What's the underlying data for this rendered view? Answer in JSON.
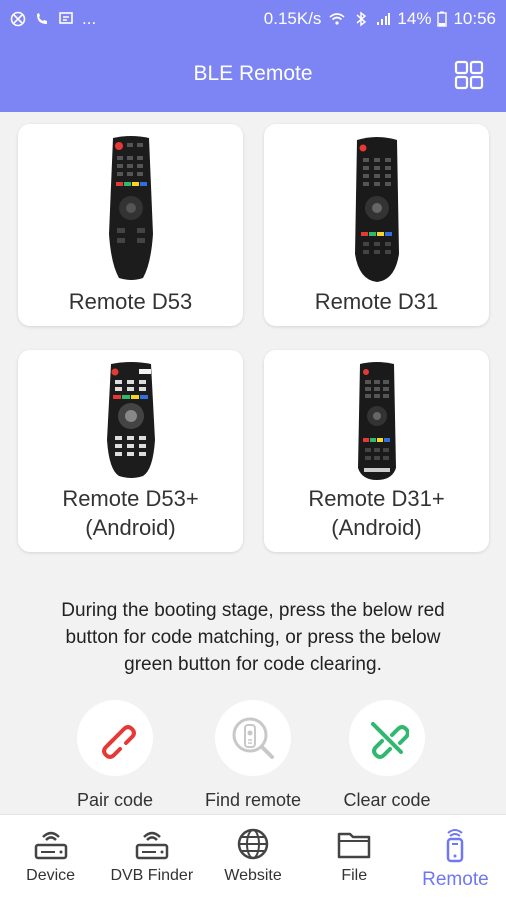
{
  "status_bar": {
    "dots": "...",
    "speed": "0.15K/s",
    "battery": "14%",
    "time": "10:56"
  },
  "app_bar": {
    "title": "BLE Remote",
    "grid_icon": "grid-icon"
  },
  "remotes": [
    {
      "label": "Remote D53"
    },
    {
      "label": "Remote D31"
    },
    {
      "label_line1": "Remote D53+",
      "label_line2": "(Android)"
    },
    {
      "label_line1": "Remote D31+",
      "label_line2": "(Android)"
    }
  ],
  "instructions": {
    "line1": "During the booting stage, press the below red",
    "line2": "button for code matching, or press the below",
    "line3": "green button for code clearing."
  },
  "actions": [
    {
      "label": "Pair code",
      "icon": "link-icon",
      "color": "#e53935"
    },
    {
      "label": "Find remote",
      "icon": "find-remote-icon",
      "color": "#c8c8c8"
    },
    {
      "label": "Clear code",
      "icon": "unlink-icon",
      "color": "#2fb86e"
    }
  ],
  "bottom_nav": [
    {
      "label": "Device",
      "icon": "router-icon",
      "active": false
    },
    {
      "label": "DVB Finder",
      "icon": "router-icon",
      "active": false
    },
    {
      "label": "Website",
      "icon": "globe-icon",
      "active": false
    },
    {
      "label": "File",
      "icon": "folder-icon",
      "active": false
    },
    {
      "label": "Remote",
      "icon": "remote-phone-icon",
      "active": true
    }
  ],
  "colors": {
    "accent": "#7d84f3",
    "nav_active": "#6f78f0"
  }
}
